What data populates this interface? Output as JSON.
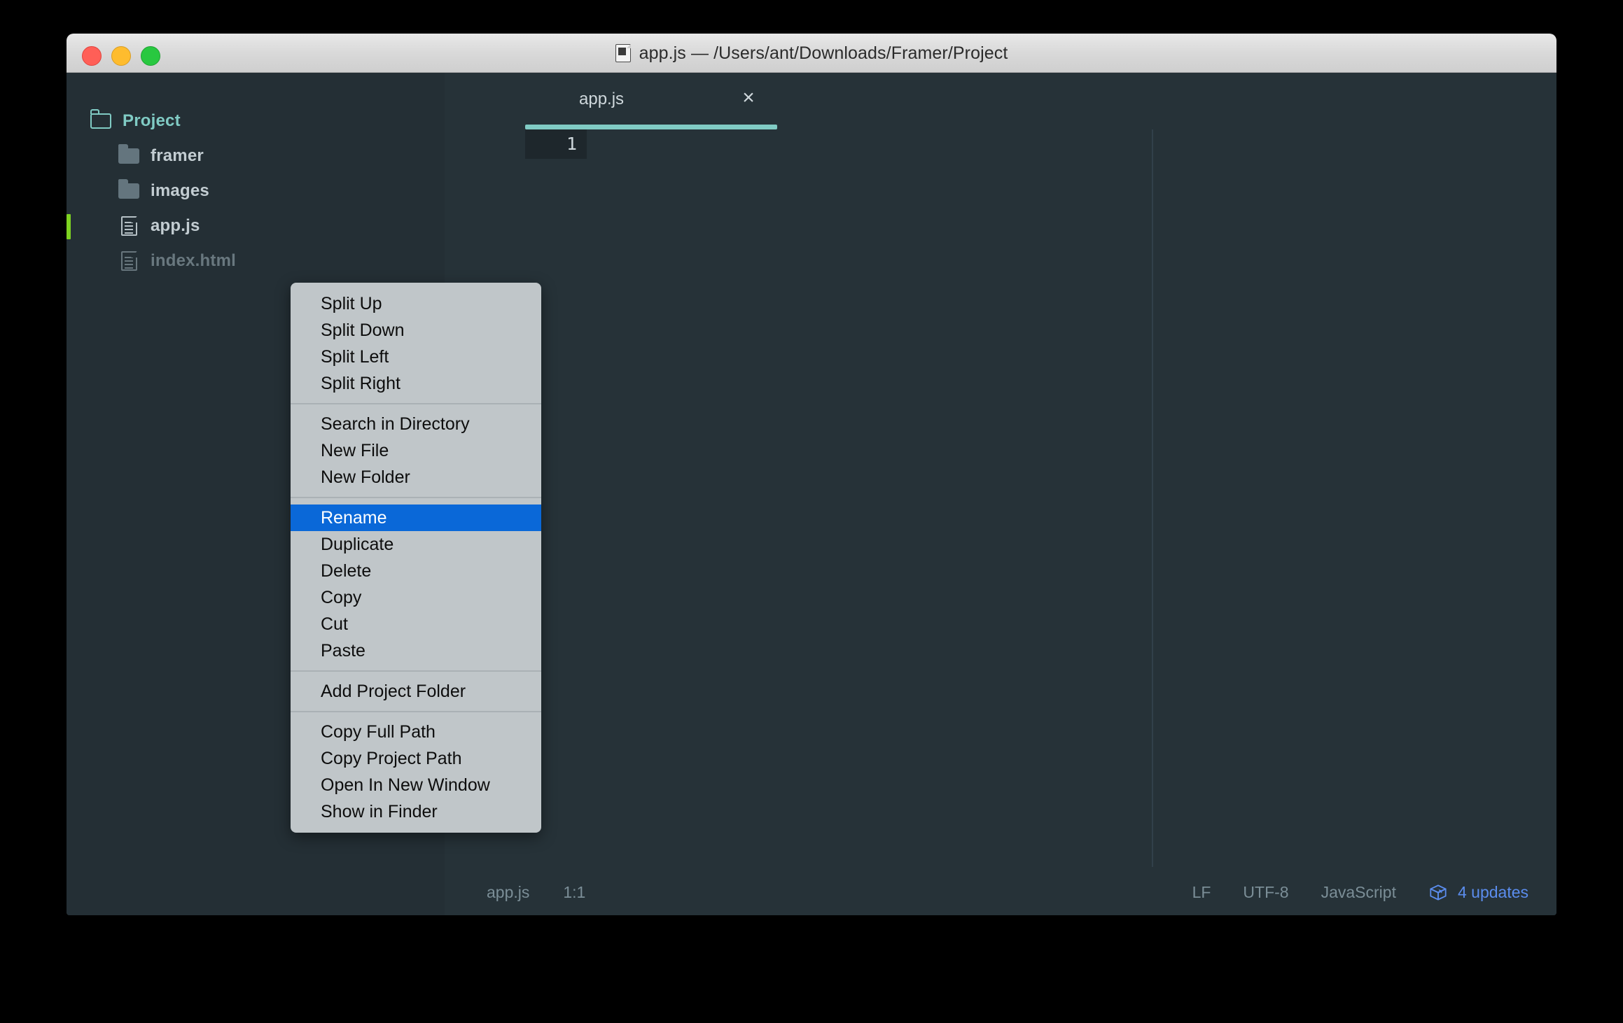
{
  "window": {
    "title": "app.js — /Users/ant/Downloads/Framer/Project",
    "title_icon": "document-icon",
    "traffic_lights": [
      {
        "name": "close",
        "color": "#ff5f57"
      },
      {
        "name": "minimize",
        "color": "#febc2e"
      },
      {
        "name": "maximize",
        "color": "#28c840"
      }
    ]
  },
  "sidebar": {
    "items": [
      {
        "label": "Project",
        "icon": "folder-open-icon",
        "depth": 0,
        "state": "root",
        "marker": false
      },
      {
        "label": "framer",
        "icon": "folder-icon",
        "depth": 1,
        "state": "normal",
        "marker": false
      },
      {
        "label": "images",
        "icon": "folder-icon",
        "depth": 1,
        "state": "normal",
        "marker": false
      },
      {
        "label": "app.js",
        "icon": "file-icon",
        "depth": 1,
        "state": "selected",
        "marker": true
      },
      {
        "label": "index.html",
        "icon": "file-icon",
        "depth": 1,
        "state": "dimmed",
        "marker": false
      }
    ],
    "marker_color": "#7ed321",
    "accent_color": "#80cbc4"
  },
  "editor": {
    "tab": {
      "label": "app.js",
      "close_icon": "close-icon",
      "underline_color": "#80cbc4"
    },
    "gutter": {
      "line_number": "1"
    },
    "content": ""
  },
  "context_menu": {
    "groups": [
      {
        "items": [
          {
            "label": "Split Up",
            "selected": false
          },
          {
            "label": "Split Down",
            "selected": false
          },
          {
            "label": "Split Left",
            "selected": false
          },
          {
            "label": "Split Right",
            "selected": false
          }
        ]
      },
      {
        "items": [
          {
            "label": "Search in Directory",
            "selected": false
          },
          {
            "label": "New File",
            "selected": false
          },
          {
            "label": "New Folder",
            "selected": false
          }
        ]
      },
      {
        "items": [
          {
            "label": "Rename",
            "selected": true
          },
          {
            "label": "Duplicate",
            "selected": false
          },
          {
            "label": "Delete",
            "selected": false
          },
          {
            "label": "Copy",
            "selected": false
          },
          {
            "label": "Cut",
            "selected": false
          },
          {
            "label": "Paste",
            "selected": false
          }
        ]
      },
      {
        "items": [
          {
            "label": "Add Project Folder",
            "selected": false
          }
        ]
      },
      {
        "items": [
          {
            "label": "Copy Full Path",
            "selected": false
          },
          {
            "label": "Copy Project Path",
            "selected": false
          },
          {
            "label": "Open In New Window",
            "selected": false
          },
          {
            "label": "Show in Finder",
            "selected": false
          }
        ]
      }
    ],
    "highlight_color": "#0a68d8"
  },
  "status_bar": {
    "left": [
      {
        "name": "file-name",
        "label": "app.js"
      },
      {
        "name": "cursor-position",
        "label": "1:1"
      }
    ],
    "right": [
      {
        "name": "line-ending",
        "label": "LF"
      },
      {
        "name": "encoding",
        "label": "UTF-8"
      },
      {
        "name": "grammar",
        "label": "JavaScript"
      }
    ],
    "updates": {
      "label": "4 updates",
      "icon": "package-box-icon",
      "color": "#5b8dee"
    }
  }
}
